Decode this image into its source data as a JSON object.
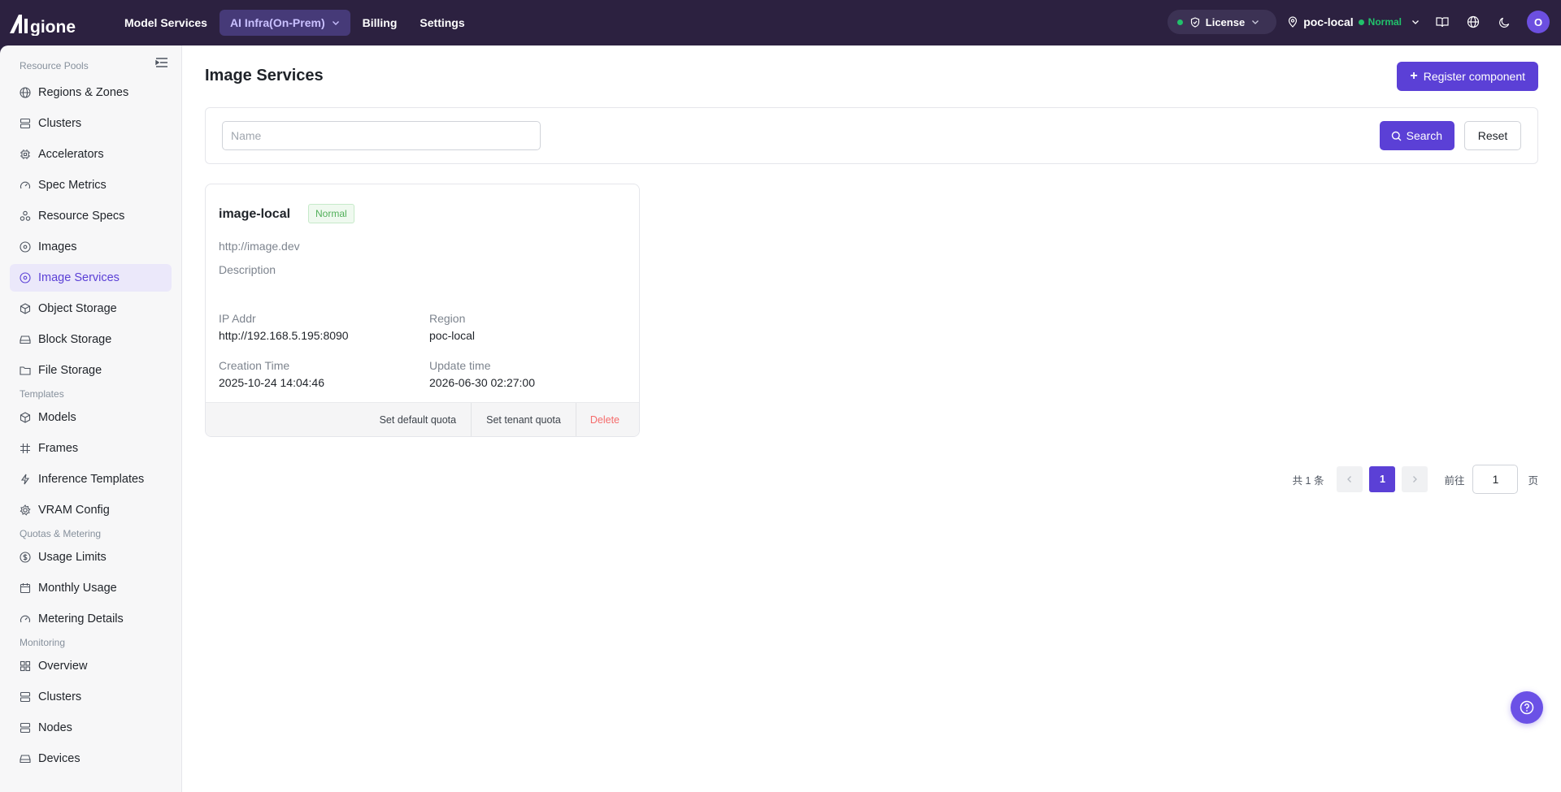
{
  "header": {
    "brand": "AIGONE",
    "nav": [
      {
        "label": "Model Services"
      },
      {
        "label": "AI Infra(On-Prem)"
      },
      {
        "label": "Billing"
      },
      {
        "label": "Settings"
      }
    ],
    "license_label": "License",
    "region_name": "poc-local",
    "region_status": "Normal",
    "avatar_initial": "O",
    "icons": [
      "docs-icon",
      "globe-icon",
      "moon-icon"
    ]
  },
  "sidebar": {
    "groups": [
      {
        "label": "Resource Pools",
        "items": [
          {
            "label": "Regions & Zones",
            "icon": "globe-icon"
          },
          {
            "label": "Clusters",
            "icon": "server-icon"
          },
          {
            "label": "Accelerators",
            "icon": "chip-icon"
          },
          {
            "label": "Spec Metrics",
            "icon": "gauge-icon"
          },
          {
            "label": "Resource Specs",
            "icon": "cluster-icon"
          },
          {
            "label": "Images",
            "icon": "disc-icon"
          },
          {
            "label": "Image Services",
            "icon": "disc-icon",
            "active": true
          },
          {
            "label": "Object Storage",
            "icon": "cube-icon"
          },
          {
            "label": "Block Storage",
            "icon": "drive-icon"
          },
          {
            "label": "File Storage",
            "icon": "folder-icon"
          }
        ]
      },
      {
        "label": "Templates",
        "items": [
          {
            "label": "Models",
            "icon": "cube-icon"
          },
          {
            "label": "Frames",
            "icon": "hash-icon"
          },
          {
            "label": "Inference Templates",
            "icon": "bolt-icon"
          },
          {
            "label": "VRAM Config",
            "icon": "gear-icon"
          }
        ]
      },
      {
        "label": "Quotas & Metering",
        "items": [
          {
            "label": "Usage Limits",
            "icon": "coin-icon"
          },
          {
            "label": "Monthly Usage",
            "icon": "calendar-icon"
          },
          {
            "label": "Metering Details",
            "icon": "gauge-icon"
          }
        ]
      },
      {
        "label": "Monitoring",
        "items": [
          {
            "label": "Overview",
            "icon": "grid-icon"
          },
          {
            "label": "Clusters",
            "icon": "server-icon"
          },
          {
            "label": "Nodes",
            "icon": "server-icon"
          },
          {
            "label": "Devices",
            "icon": "drive-icon"
          }
        ]
      }
    ]
  },
  "main": {
    "title": "Image Services",
    "register_label": "Register component",
    "search": {
      "placeholder": "Name",
      "value": ""
    },
    "search_label": "Search",
    "reset_label": "Reset",
    "card": {
      "name": "image-local",
      "status": "Normal",
      "url": "http://image.dev",
      "description": "Description",
      "ip_label": "IP Addr",
      "ip_value": "http://192.168.5.195:8090",
      "region_label": "Region",
      "region_value": "poc-local",
      "created_label": "Creation Time",
      "created_value": "2025-10-24 14:04:46",
      "updated_label": "Update time",
      "updated_value": "2026-06-30 02:27:00",
      "actions": {
        "default_quota": "Set default quota",
        "tenant_quota": "Set tenant quota",
        "delete": "Delete"
      }
    },
    "pagination": {
      "total": "共 1 条",
      "current": "1",
      "goto": "前往",
      "goto_value": "1",
      "unit": "页"
    }
  },
  "colors": {
    "accent": "#5b40d6",
    "topbar": "#2c2140",
    "success": "#21c16b",
    "danger": "#f56c6c"
  }
}
